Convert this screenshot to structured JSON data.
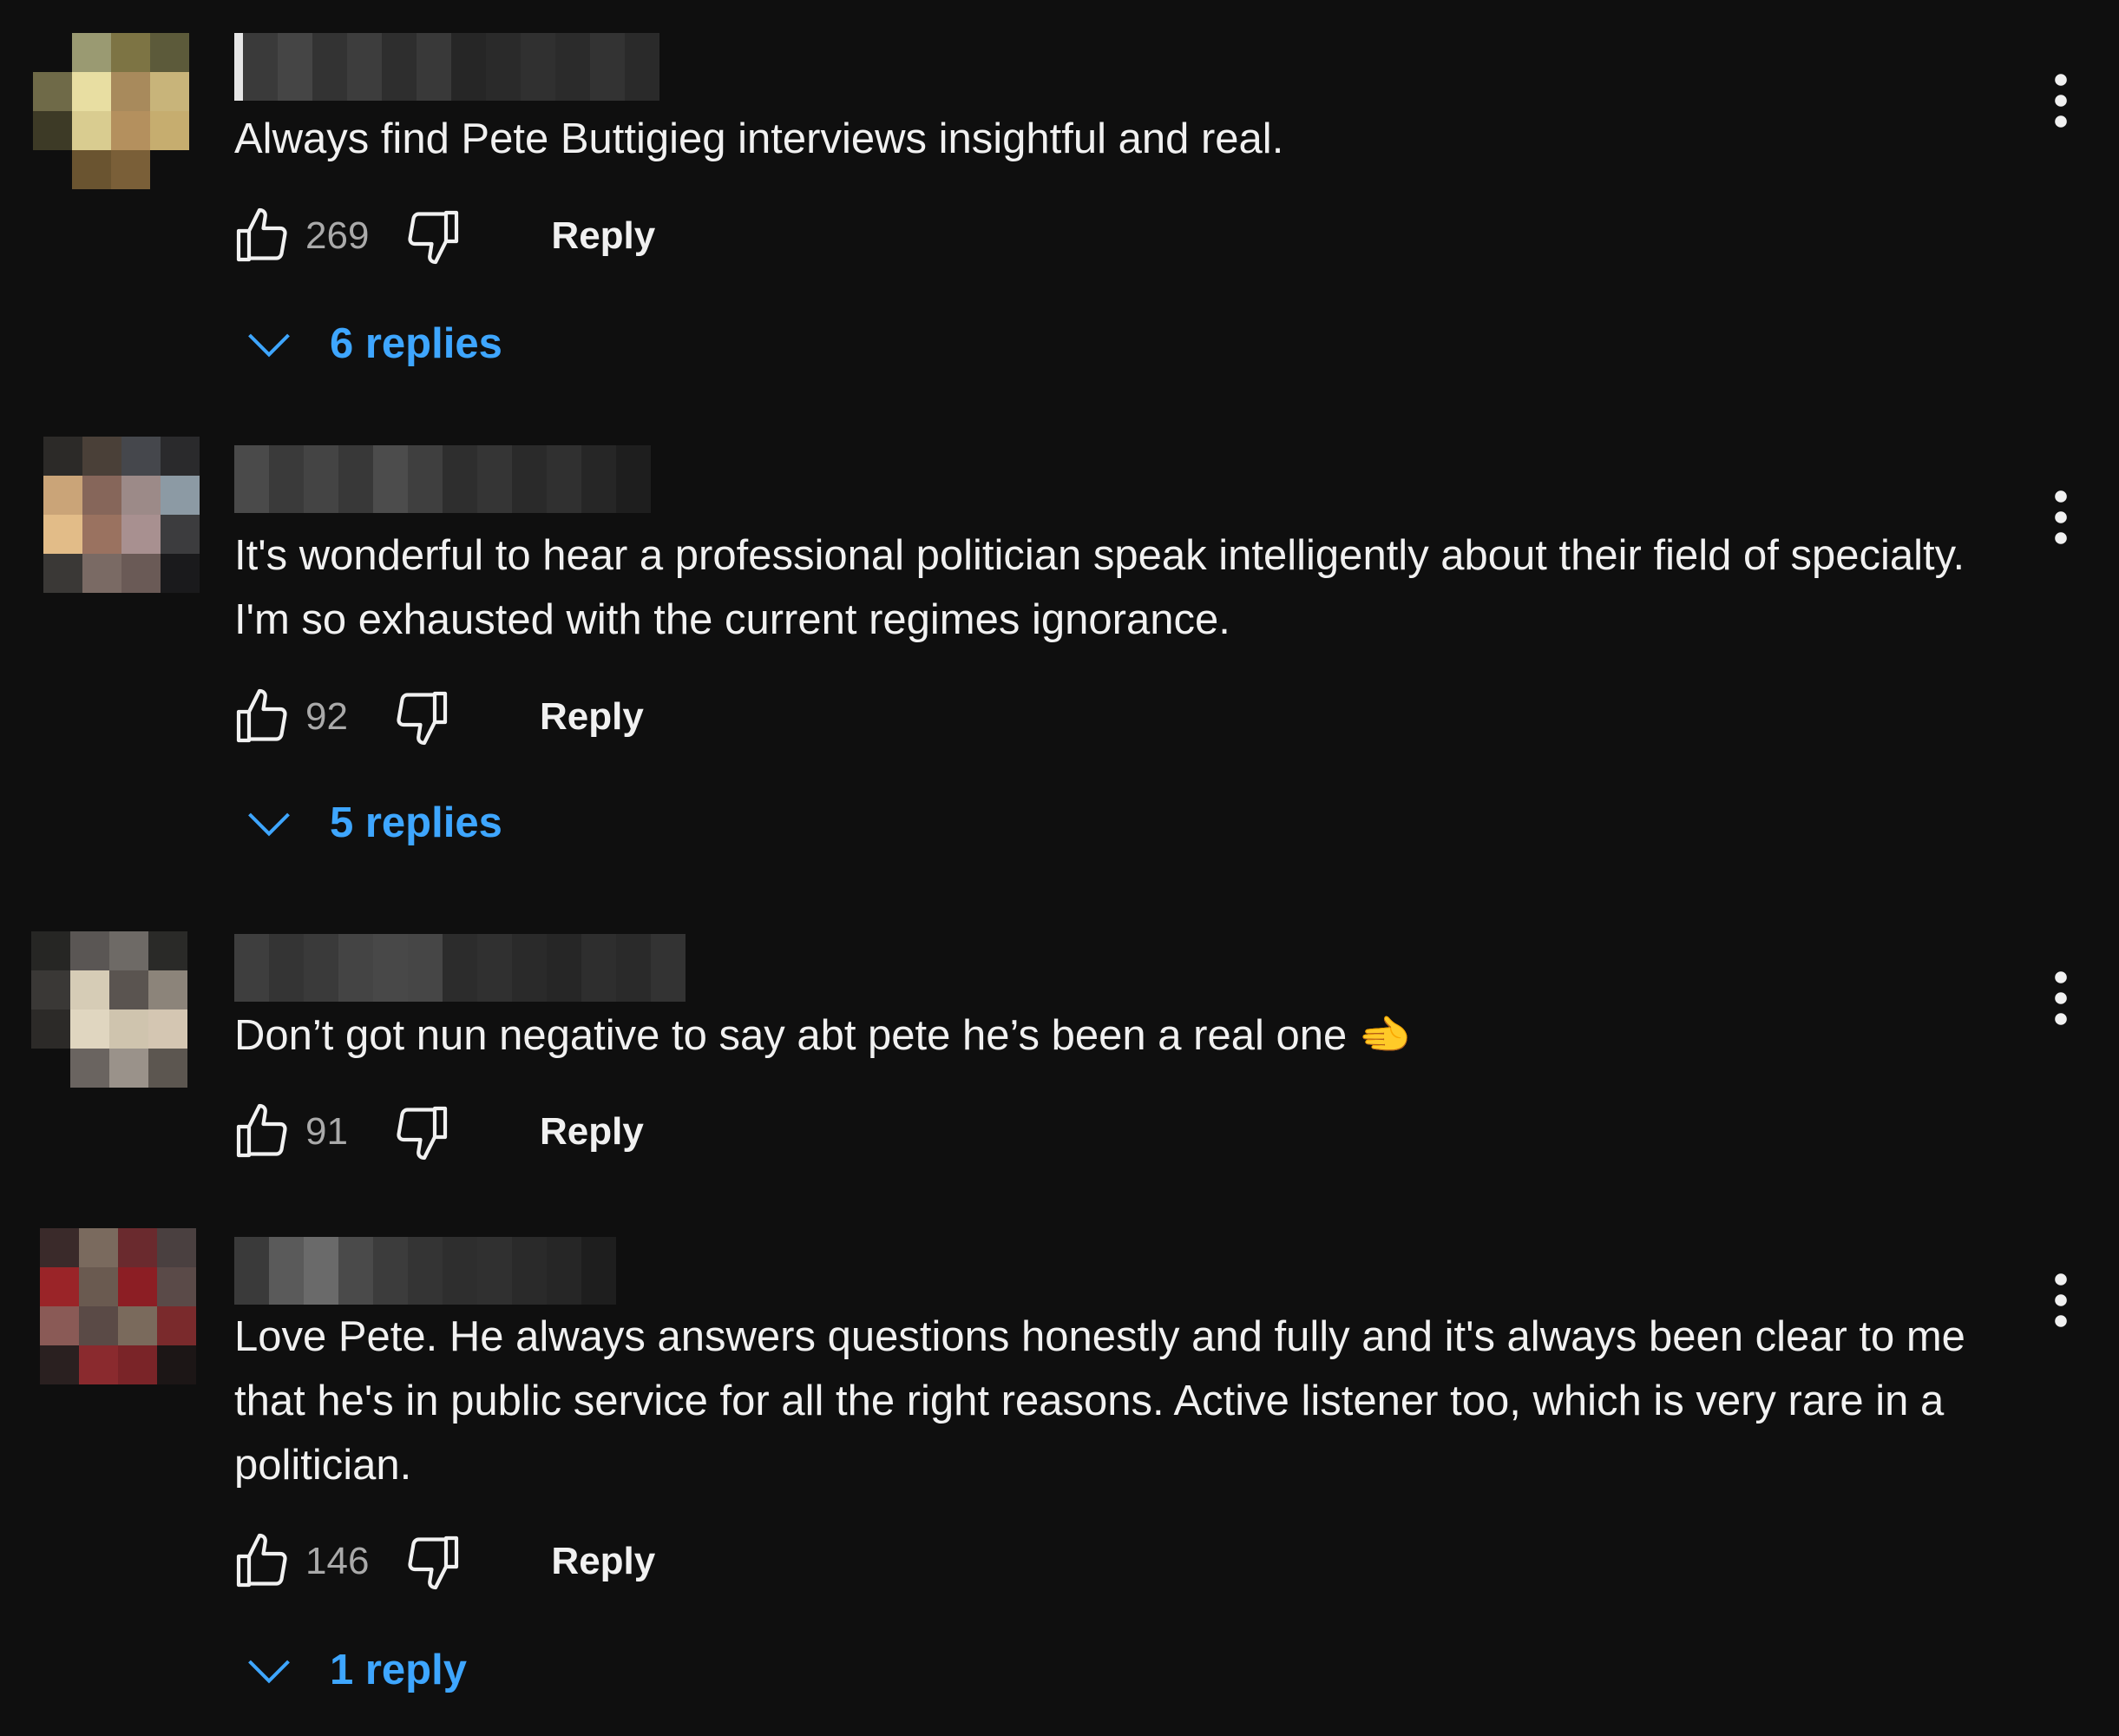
{
  "comments": [
    {
      "author": "",
      "text": "Always find Pete Buttigieg interviews insightful and real.",
      "likes": "269",
      "reply_label": "Reply",
      "replies_label": "6 replies"
    },
    {
      "author": "",
      "text": "It's wonderful to hear a professional politician speak intelligently about their field of specialty.  I'm so exhausted with the current regimes ignorance.",
      "likes": "92",
      "reply_label": "Reply",
      "replies_label": "5 replies"
    },
    {
      "author": "",
      "text": "Don’t got nun negative to say abt pete he’s been a real one 🫲",
      "likes": "91",
      "reply_label": "Reply",
      "replies_label": ""
    },
    {
      "author": "",
      "text": "Love Pete. He always answers questions honestly and fully and it's always been clear to me that he's in public service for all the right reasons. Active listener too, which is very rare in a politician.",
      "likes": "146",
      "reply_label": "Reply",
      "replies_label": "1 reply"
    }
  ],
  "colors": {
    "background": "#0f0f0f",
    "text": "#f1f1f1",
    "muted": "#aaaaaa",
    "link": "#3ea6ff"
  },
  "icons": {
    "like": "thumbs-up-icon",
    "dislike": "thumbs-down-icon",
    "expand": "chevron-down-icon",
    "menu": "more-vertical-icon"
  }
}
